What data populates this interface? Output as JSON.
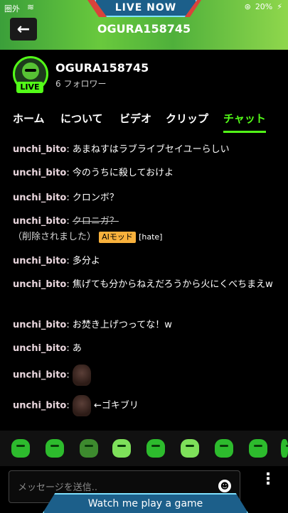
{
  "status_bar": {
    "carrier": "圏外",
    "battery": "20%"
  },
  "banner": {
    "live_now": "LIVE NOW"
  },
  "header": {
    "title": "OGURA158745"
  },
  "channel": {
    "name": "OGURA158745",
    "followers": "6 フォロワー",
    "live_badge": "LIVE"
  },
  "tabs": [
    {
      "label": "ホーム"
    },
    {
      "label": "について"
    },
    {
      "label": "ビデオ"
    },
    {
      "label": "クリップ"
    },
    {
      "label": "チャット",
      "active": true
    }
  ],
  "chat": {
    "messages": [
      {
        "user": "unchi_bito",
        "text": "あまねすはラブライブセイユーらしい"
      },
      {
        "user": "unchi_bito",
        "text": "今のうちに殺しておけよ"
      },
      {
        "user": "unchi_bito",
        "text": "クロンボ？"
      },
      {
        "user": "unchi_bito",
        "text": "クロニガ？",
        "deleted_note": "（削除されました）",
        "badge": "AIモッド",
        "tag": "[hate]"
      },
      {
        "user": "unchi_bito",
        "text": "多分よ"
      },
      {
        "user": "unchi_bito",
        "text": "焦げても分からねえだろうから火にくべちまえw"
      },
      {
        "user": "unchi_bito",
        "text": "お焚き上げつってな！w"
      },
      {
        "user": "unchi_bito",
        "text": "あ"
      },
      {
        "user": "unchi_bito",
        "emote": "cockroach-emote"
      },
      {
        "user": "unchi_bito",
        "emote": "cockroach-emote",
        "text": "←ゴキブリ"
      }
    ]
  },
  "input": {
    "placeholder": "メッセージを送信.."
  },
  "promo_banner": {
    "text": "Watch me play a game"
  },
  "colors": {
    "accent": "#53fc18",
    "banner_blue": "#1c5f8a",
    "ai_badge": "#f8b13c"
  }
}
